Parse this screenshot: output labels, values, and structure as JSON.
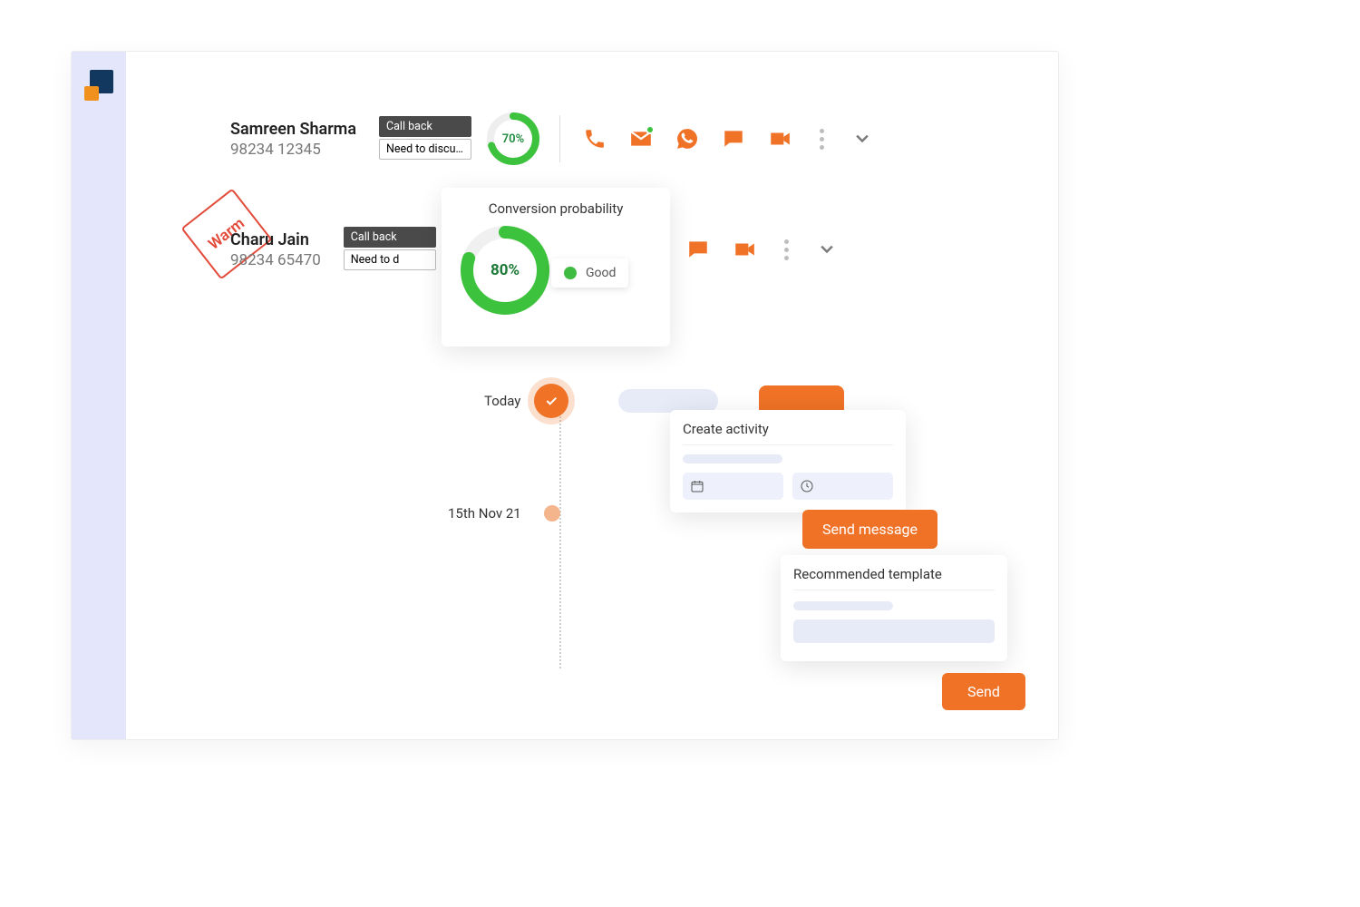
{
  "contacts": [
    {
      "name": "Samreen Sharma",
      "phone": "98234 12345",
      "tag_primary": "Call back",
      "tag_secondary": "Need to discu…",
      "conversion_pct": "70%",
      "ring_value": 70
    },
    {
      "name": "Charu Jain",
      "phone": "98234 65470",
      "tag_primary": "Call back",
      "tag_secondary": "Need to d",
      "conversion_pct": "80%",
      "ring_value": 80
    }
  ],
  "stamp_label": "Warm",
  "conversion_card": {
    "title": "Conversion probability",
    "pct": "80%",
    "status": "Good"
  },
  "timeline": {
    "today_label": "Today",
    "past_label": "15th Nov 21"
  },
  "create_activity": {
    "title": "Create activity",
    "send_message_label": "Send message"
  },
  "recommended": {
    "title": "Recommended template",
    "send_label": "Send"
  },
  "icons": {
    "phone": "phone-icon",
    "mail": "mail-icon",
    "whatsapp": "whatsapp-icon",
    "chat": "chat-icon",
    "video": "video-icon"
  },
  "colors": {
    "accent": "#ef7227",
    "green": "#3cc23c",
    "sidebar": "#e4e7fb"
  }
}
